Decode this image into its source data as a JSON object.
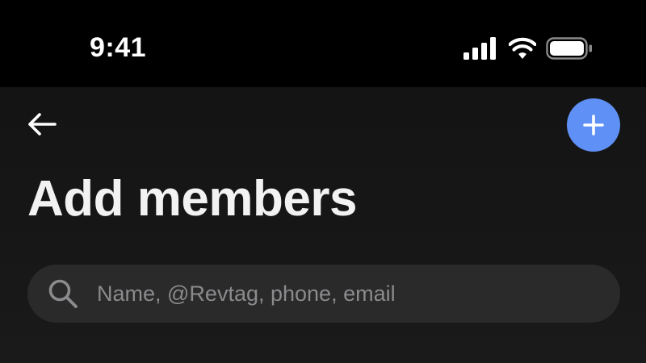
{
  "status_bar": {
    "time": "9:41",
    "icons": [
      "signal-icon",
      "wifi-icon",
      "battery-icon"
    ]
  },
  "header": {
    "back_icon": "arrow-left-icon",
    "add_icon": "plus-icon",
    "add_button_color": "#5f90f5"
  },
  "page": {
    "title": "Add members"
  },
  "search": {
    "icon": "search-icon",
    "placeholder": "Name, @Revtag, phone, email",
    "value": ""
  },
  "colors": {
    "background": "#151515",
    "status_bar": "#000000",
    "search_field": "#2a2a2b",
    "placeholder": "#8b8b8d",
    "accent": "#5f90f5"
  }
}
